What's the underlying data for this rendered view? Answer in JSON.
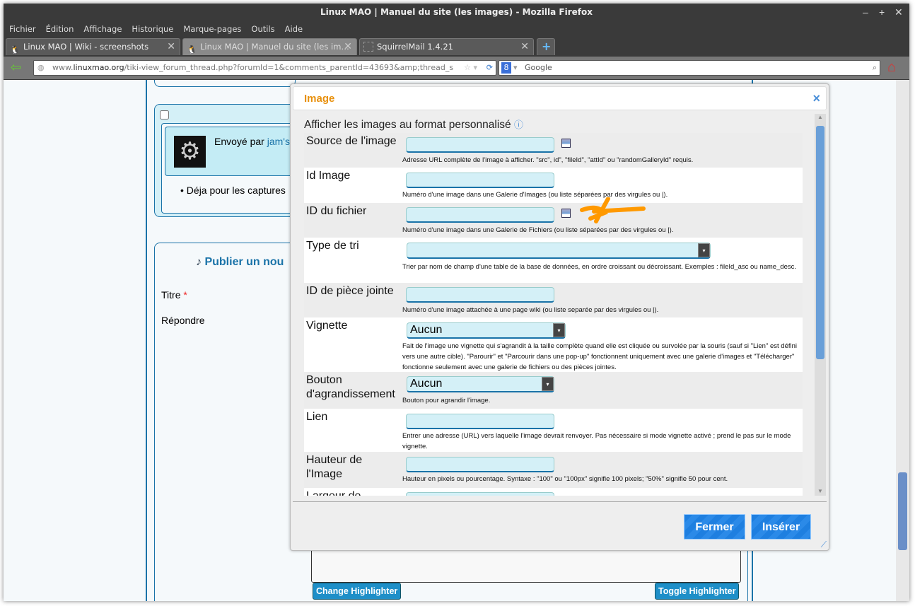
{
  "window": {
    "title": "Linux MAO | Manuel du site (les images) - Mozilla Firefox",
    "controls": [
      "–",
      "+",
      "✕"
    ]
  },
  "menu": [
    "Fichier",
    "Édition",
    "Affichage",
    "Historique",
    "Marque-pages",
    "Outils",
    "Aide"
  ],
  "tabs": [
    {
      "label": "Linux MAO | Wiki - screenshots"
    },
    {
      "label": "Linux MAO | Manuel du site (les im…"
    },
    {
      "label": "SquirrelMail 1.4.21"
    }
  ],
  "nav": {
    "url_domain_prefix": "www.",
    "url_domain": "linuxmao.org",
    "url_path": "/tiki-view_forum_thread.php?forumId=1&comments_parentId=43693&amp;thread_s",
    "search_placeholder": "Google"
  },
  "page": {
    "sent_by": "Envoyé par ",
    "author": "jam's",
    "bullet": "Déja pour les captures",
    "publish_title": "Publier un nou",
    "title_label": "Titre",
    "required": "*",
    "reply_label": "Répondre",
    "change_highlighter": "Change Highlighter",
    "toggle_highlighter": "Toggle Highlighter"
  },
  "dialog": {
    "title": "Image",
    "close": "×",
    "intro": "Afficher les images au format personnalisé",
    "fields": [
      {
        "label": "Source de l'image",
        "help": "Adresse URL complète de l'image à afficher. \"src\", id\", \"fileId\", \"attId\" ou \"randomGalleryId\" requis."
      },
      {
        "label": "Id Image",
        "help": "Numéro d'une image dans une Galerie d'Images (ou liste séparées par des virgules ou |)."
      },
      {
        "label": "ID du fichier",
        "help": "Numéro d'une image dans une Galerie de Fichiers (ou liste séparées par des virgules ou |)."
      },
      {
        "label": "Type de tri",
        "help": "Trier par nom de champ d'une table de la base de données, en ordre croissant ou décroissant. Exemples : fileId_asc ou name_desc."
      },
      {
        "label": "ID de pièce jointe",
        "help": "Numéro d'une image attachée à une page wiki (ou liste separée par des virgules ou |)."
      },
      {
        "label": "Vignette",
        "value": "Aucun",
        "help": "Fait de l'image une vignette qui s'agrandit à la taille complète quand elle est cliquée ou survolée par la souris (sauf si \"Lien\" est défini vers une autre cible). \"Parourir\" et \"Parcourir dans une pop-up\" fonctionnent uniquement avec une galerie d'images et \"Télécharger\" fonctionne seulement avec une galerie de fichiers ou des pièces jointes."
      },
      {
        "label": "Bouton d'agrandissement",
        "value": "Aucun",
        "help": "Bouton pour agrandir l'image."
      },
      {
        "label": "Lien",
        "help": "Entrer une adresse (URL) vers laquelle l'image devrait renvoyer. Pas nécessaire si mode vignette activé ; prend le pas sur le mode vignette."
      },
      {
        "label": "Hauteur de l'Image",
        "help": "Hauteur en pixels ou pourcentage. Syntaxe : \"100\" ou \"100px\" signifie 100 pixels; \"50%\" signifie 50 pour cent."
      },
      {
        "label": "Largeur de"
      }
    ],
    "close_button": "Fermer",
    "insert_button": "Insérer"
  },
  "colors": {
    "accent": "#e8900c",
    "link": "#1a73a8",
    "button": "#1e7fe0"
  }
}
